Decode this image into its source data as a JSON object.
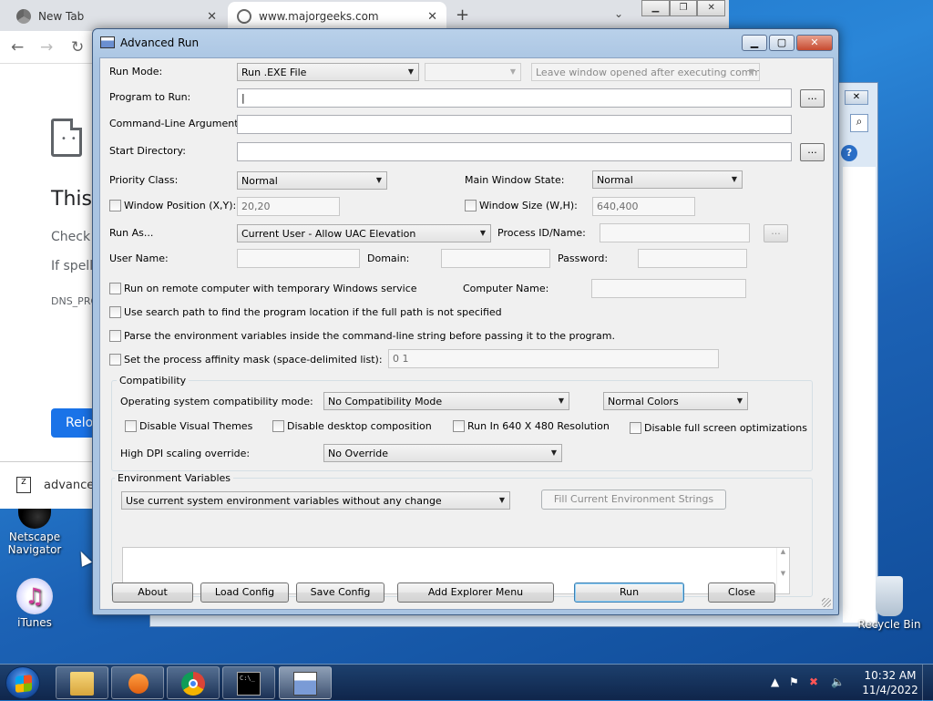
{
  "browser": {
    "tabs": [
      {
        "label": "New Tab"
      },
      {
        "label": "www.majorgeeks.com"
      }
    ],
    "new_tab": "+",
    "tab_menu": "⌄",
    "error_title": "This",
    "error_lines": [
      "Check i",
      "If spelli"
    ],
    "error_code": "DNS_PRO",
    "reload_label": "Relo",
    "download_item": "advance"
  },
  "dialog": {
    "title": "Advanced Run",
    "labels": {
      "run_mode": "Run Mode:",
      "program": "Program to Run:",
      "args": "Command-Line Arguments:",
      "start_dir": "Start Directory:",
      "priority": "Priority Class:",
      "main_window_state": "Main Window State:",
      "window_position": "Window Position (X,Y):",
      "window_size": "Window Size (W,H):",
      "run_as": "Run As...",
      "process_id": "Process ID/Name:",
      "user_name": "User Name:",
      "domain": "Domain:",
      "password": "Password:",
      "computer_name": "Computer Name:",
      "os_compat": "Operating system compatibility mode:",
      "high_dpi": "High DPI scaling override:"
    },
    "values": {
      "run_mode": "Run .EXE File",
      "run_mode_extra": "",
      "leave_window": "Leave window opened after executing command",
      "program": "|",
      "args": "",
      "start_dir": "",
      "priority": "Normal",
      "main_window_state": "Normal",
      "window_position": "20,20",
      "window_size": "640,400",
      "run_as": "Current User - Allow UAC Elevation",
      "process_id": "",
      "user_name": "",
      "domain": "",
      "password": "",
      "computer_name": "",
      "affinity": "0 1",
      "os_compat": "No Compatibility Mode",
      "colors": "Normal Colors",
      "high_dpi": "No Override",
      "env_mode": "Use current system environment variables without any change"
    },
    "browse_label": "...",
    "checkboxes": {
      "remote": "Run on remote computer with temporary Windows service",
      "search_path": "Use search path to find the program location if the full path is not specified",
      "parse_env": "Parse the environment variables inside the command-line string before passing it to the program.",
      "affinity": "Set the process affinity mask (space-delimited list):",
      "disable_themes": "Disable Visual Themes",
      "disable_composition": "Disable desktop composition",
      "res_640": "Run In 640 X 480 Resolution",
      "disable_fullscreen": "Disable full screen optimizations"
    },
    "groups": {
      "compatibility": "Compatibility",
      "environment": "Environment Variables"
    },
    "fill_env_button": "Fill Current Environment Strings",
    "buttons": {
      "about": "About",
      "load_config": "Load Config",
      "save_config": "Save Config",
      "add_explorer": "Add Explorer Menu",
      "run": "Run",
      "close": "Close"
    }
  },
  "desktop": {
    "icons": [
      {
        "label": "Netscape Navigator"
      },
      {
        "label": "iTunes"
      },
      {
        "label": "Recycle Bin"
      }
    ]
  },
  "taskbar": {
    "time": "10:32 AM",
    "date": "11/4/2022"
  }
}
